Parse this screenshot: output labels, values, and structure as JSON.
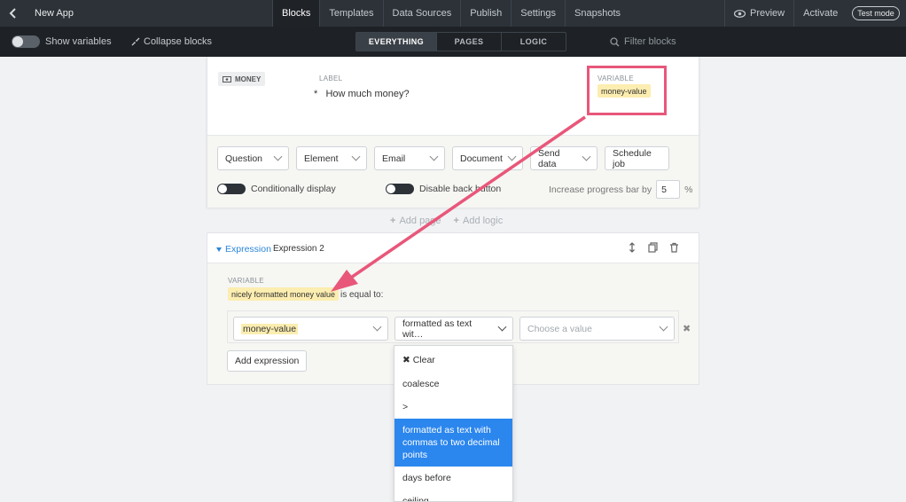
{
  "topbar": {
    "app_name": "New App",
    "tabs": [
      {
        "label": "Blocks",
        "active": true
      },
      {
        "label": "Templates",
        "active": false
      },
      {
        "label": "Data Sources",
        "active": false
      },
      {
        "label": "Publish",
        "active": false
      },
      {
        "label": "Settings",
        "active": false
      },
      {
        "label": "Snapshots",
        "active": false
      }
    ],
    "preview_label": "Preview",
    "activate_label": "Activate",
    "test_mode_label": "Test mode"
  },
  "subbar": {
    "show_variables_label": "Show variables",
    "collapse_blocks_label": "Collapse blocks",
    "view_tabs": [
      "EVERYTHING",
      "PAGES",
      "LOGIC"
    ],
    "filter_placeholder": "Filter blocks"
  },
  "question_block": {
    "type_tag": "MONEY",
    "label_caption": "LABEL",
    "required_marker": "*",
    "label_text": "How much money?",
    "variable_caption": "VARIABLE",
    "variable_name": "money-value",
    "dropdowns": [
      "Question",
      "Element",
      "Email",
      "Document",
      "Send data"
    ],
    "schedule_job_label": "Schedule job",
    "conditionally_display_label": "Conditionally display",
    "disable_back_label": "Disable back button",
    "progress_label": "Increase progress bar by",
    "progress_value": "5",
    "progress_unit": "%"
  },
  "add_row": {
    "add_page_label": "Add page",
    "add_logic_label": "Add logic"
  },
  "expression_block": {
    "type_label": "Expression",
    "name": "Expression 2",
    "variable_caption": "VARIABLE",
    "variable_name": "nicely formatted money value",
    "equal_text": "is equal to:",
    "operand_value": "money-value",
    "operator_value": "formatted as text wit…",
    "value_placeholder": "Choose a value",
    "remove_symbol": "✖",
    "add_expression_label": "Add expression"
  },
  "operator_menu": {
    "items": [
      {
        "label": "✖ Clear",
        "selected": false
      },
      {
        "label": "coalesce",
        "selected": false
      },
      {
        "label": ">",
        "selected": false
      },
      {
        "label": "formatted as text with commas to two decimal points",
        "selected": true
      },
      {
        "label": "days before",
        "selected": false
      },
      {
        "label": "ceiling",
        "selected": false
      }
    ]
  },
  "colors": {
    "topbar_bg": "#2c3238",
    "subbar_bg": "#1e2226",
    "variable_pill": "#fcedb0",
    "link_blue": "#2b86d9",
    "menu_selected": "#2b86ee",
    "annotation_pink": "#e8577a"
  }
}
